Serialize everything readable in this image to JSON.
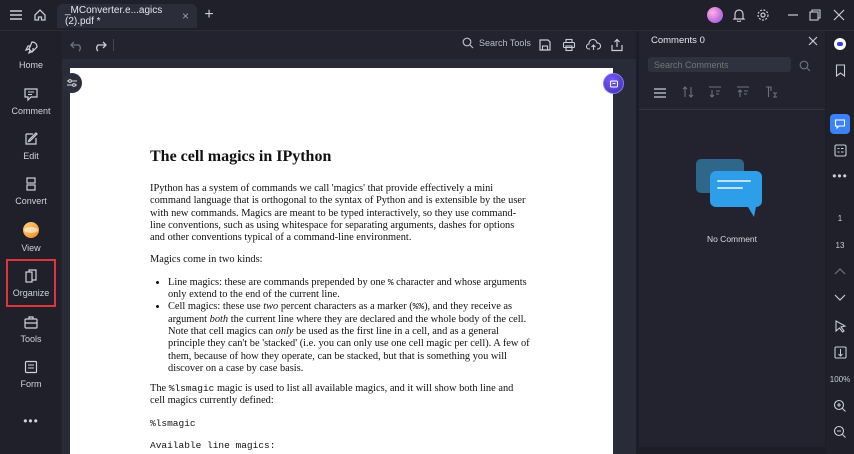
{
  "titlebar": {
    "tab_title": "_MConverter.e...agics (2).pdf *",
    "tab_close": "×",
    "new_tab": "+"
  },
  "sidebar": {
    "items": [
      {
        "label": "Home"
      },
      {
        "label": "Comment"
      },
      {
        "label": "Edit"
      },
      {
        "label": "Convert"
      },
      {
        "label": "View"
      },
      {
        "label": "Organize"
      },
      {
        "label": "Tools"
      },
      {
        "label": "Form"
      }
    ],
    "more": "•••",
    "selected": "Organize"
  },
  "toolbar": {
    "search_label": "Search Tools"
  },
  "document": {
    "title": "The cell magics in IPython",
    "para1": "IPython has a system of commands we call 'magics' that provide effectively a mini command language that is orthogonal to the syntax of Python and is extensible by the user with new commands. Magics are meant to be typed interactively, so they use command-line conventions, such as using whitespace for separating arguments, dashes for options and other conventions typical of a command-line environment.",
    "para2": "Magics come in two kinds:",
    "bullet1_a": "Line magics: these are commands prepended by one ",
    "bullet1_code": "%",
    "bullet1_b": " character and whose arguments only extend to the end of the current line.",
    "bullet2_a": "Cell magics: these use ",
    "bullet2_em1": "two",
    "bullet2_b": " percent characters as a marker (",
    "bullet2_code": "%%",
    "bullet2_c": "), and they receive as argument ",
    "bullet2_em2": "both",
    "bullet2_d": " the current line where they are declared and the whole body of the cell. Note that cell magics can ",
    "bullet2_em3": "only",
    "bullet2_e": " be used as the first line in a cell, and as a general principle they can't be 'stacked' (i.e. you can only use one cell magic per cell). A few of them, because of how they operate, can be stacked, but that is something you will discover on a case by case basis.",
    "para3_a": "The ",
    "para3_code": "%lsmagic",
    "para3_b": " magic is used to list all available magics, and it will show both line and cell magics currently defined:",
    "code1": "%lsmagic",
    "code2": "Available line magics:"
  },
  "comments": {
    "title": "Comments 0",
    "search_placeholder": "Search Comments",
    "empty_text": "No Comment"
  },
  "rightrail": {
    "page_current": "1",
    "page_total": "13",
    "zoom": "100%"
  },
  "colors": {
    "accent": "#3b82f6",
    "selected_border": "#e0353c",
    "background": "#1c1d27"
  }
}
